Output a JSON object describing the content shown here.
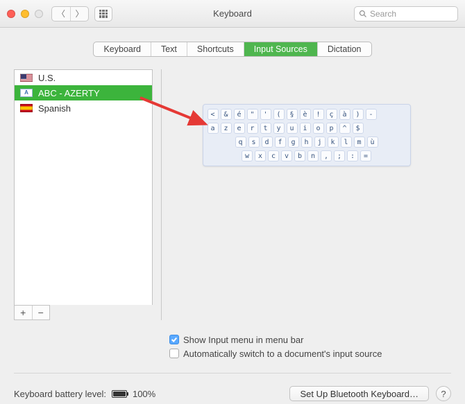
{
  "window": {
    "title": "Keyboard",
    "search_placeholder": "Search"
  },
  "tabs": [
    {
      "label": "Keyboard",
      "id": "keyboard"
    },
    {
      "label": "Text",
      "id": "text"
    },
    {
      "label": "Shortcuts",
      "id": "shortcuts"
    },
    {
      "label": "Input Sources",
      "id": "input-sources",
      "active": true
    },
    {
      "label": "Dictation",
      "id": "dictation"
    }
  ],
  "input_sources": [
    {
      "label": "U.S.",
      "icon": "us-flag",
      "selected": false
    },
    {
      "label": "ABC - AZERTY",
      "icon": "abc-badge",
      "selected": true
    },
    {
      "label": "Spanish",
      "icon": "spain-flag",
      "selected": false
    }
  ],
  "add_label": "+",
  "remove_label": "−",
  "keyboard_preview": {
    "rows": [
      [
        "<",
        "&",
        "é",
        "\"",
        "'",
        "(",
        "§",
        "è",
        "!",
        "ç",
        "à",
        ")",
        "-"
      ],
      [
        "a",
        "z",
        "e",
        "r",
        "t",
        "y",
        "u",
        "i",
        "o",
        "p",
        "^",
        "$"
      ],
      [
        "q",
        "s",
        "d",
        "f",
        "g",
        "h",
        "j",
        "k",
        "l",
        "m",
        "ù"
      ],
      [
        "w",
        "x",
        "c",
        "v",
        "b",
        "n",
        ",",
        ";",
        ":",
        "="
      ]
    ]
  },
  "options": {
    "show_input_menu": {
      "label": "Show Input menu in menu bar",
      "checked": true
    },
    "auto_switch": {
      "label": "Automatically switch to a document's input source",
      "checked": false
    }
  },
  "footer": {
    "battery_label": "Keyboard battery level:",
    "battery_pct": "100%",
    "bluetooth_button": "Set Up Bluetooth Keyboard…",
    "help_label": "?"
  },
  "annotation_arrow_color": "#e53935"
}
